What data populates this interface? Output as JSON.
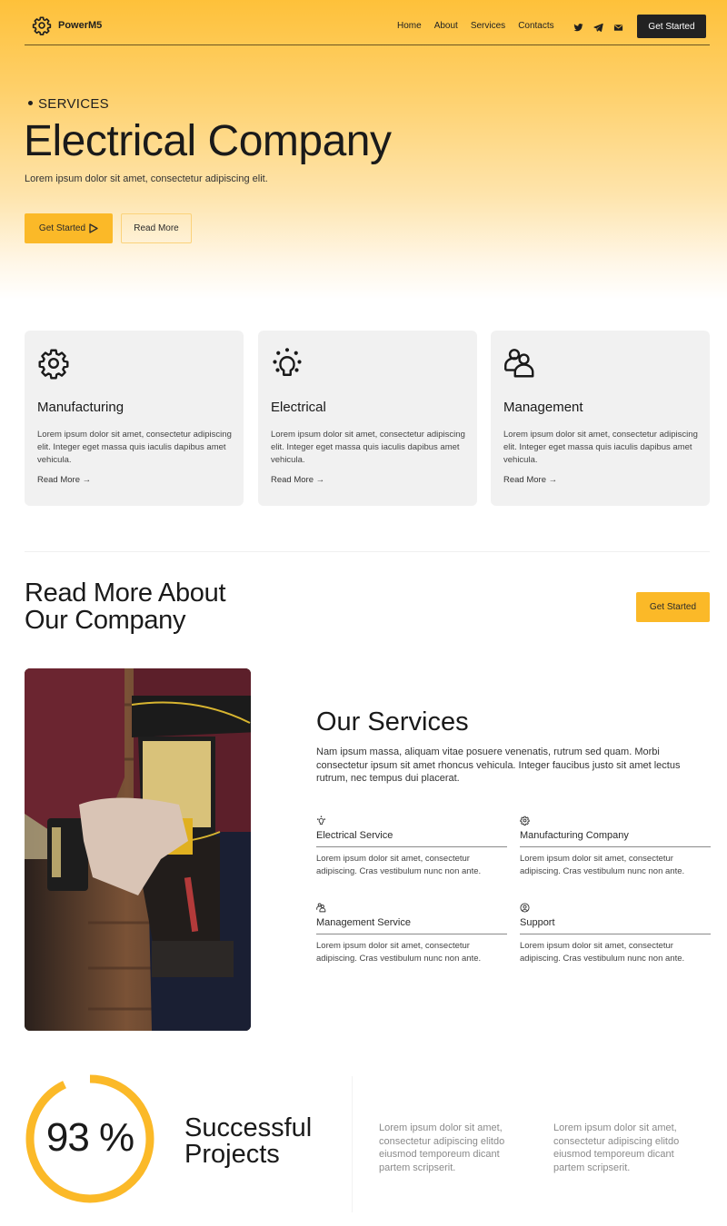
{
  "brand": {
    "name": "PowerM5",
    "accent_color": "#fbb928",
    "dark_color": "#222222"
  },
  "nav": {
    "links": [
      "Home",
      "About",
      "Services",
      "Contacts"
    ],
    "social_icons": [
      "twitter-icon",
      "telegram-icon",
      "mail-icon"
    ],
    "cta_label": "Get Started"
  },
  "hero": {
    "eyebrow": "SERVICES",
    "title": "Electrical Company",
    "subtitle": "Lorem ipsum dolor sit amet, consectetur adipiscing elit.",
    "primary_button": "Get Started",
    "secondary_button": "Read More"
  },
  "feature_cards": [
    {
      "icon": "gear-icon",
      "title": "Manufacturing",
      "text": "Lorem ipsum dolor sit amet, consectetur adipiscing elit. Integer eget massa quis iaculis dapibus amet vehicula.",
      "link": "Read More →"
    },
    {
      "icon": "lightbulb-icon",
      "title": "Electrical",
      "text": "Lorem ipsum dolor sit amet, consectetur adipiscing elit. Integer eget massa quis iaculis dapibus amet vehicula.",
      "link": "Read More →"
    },
    {
      "icon": "users-icon",
      "title": "Management",
      "text": "Lorem ipsum dolor sit amet, consectetur adipiscing elit. Integer eget massa quis iaculis dapibus amet vehicula.",
      "link": "Read More →"
    }
  ],
  "about": {
    "title_line1": "Read More About",
    "title_line2": "Our Company",
    "cta_label": "Get Started",
    "image_alt": "Worker holding a power drill in a tool belt"
  },
  "services": {
    "title": "Our Services",
    "description": "Nam ipsum massa, aliquam vitae posuere venenatis, rutrum sed quam. Morbi consectetur ipsum sit amet rhoncus vehicula. Integer faucibus justo sit amet lectus rutrum, nec tempus dui placerat.",
    "items": [
      {
        "icon": "lightbulb-icon",
        "title": "Electrical Service",
        "text": "Lorem ipsum dolor sit amet, consectetur adipiscing. Cras vestibulum nunc non ante."
      },
      {
        "icon": "gear-icon",
        "title": "Manufacturing Company",
        "text": "Lorem ipsum dolor sit amet, consectetur adipiscing. Cras vestibulum nunc non ante."
      },
      {
        "icon": "users-icon",
        "title": "Management Service",
        "text": "Lorem ipsum dolor sit amet, consectetur adipiscing. Cras vestibulum nunc non ante."
      },
      {
        "icon": "user-circle-icon",
        "title": "Support",
        "text": "Lorem ipsum dolor sit amet, consectetur adipiscing. Cras vestibulum nunc non ante."
      }
    ]
  },
  "stats": {
    "percent": 93,
    "value_label": "93 %",
    "label_line1": "Successful",
    "label_line2": "Projects",
    "texts": [
      "Lorem ipsum dolor sit amet, consectetur adipiscing elitdo eiusmod temporeum dicant partem scripserit.",
      "Lorem ipsum dolor sit amet, consectetur adipiscing elitdo eiusmod temporeum dicant partem scripserit."
    ]
  }
}
